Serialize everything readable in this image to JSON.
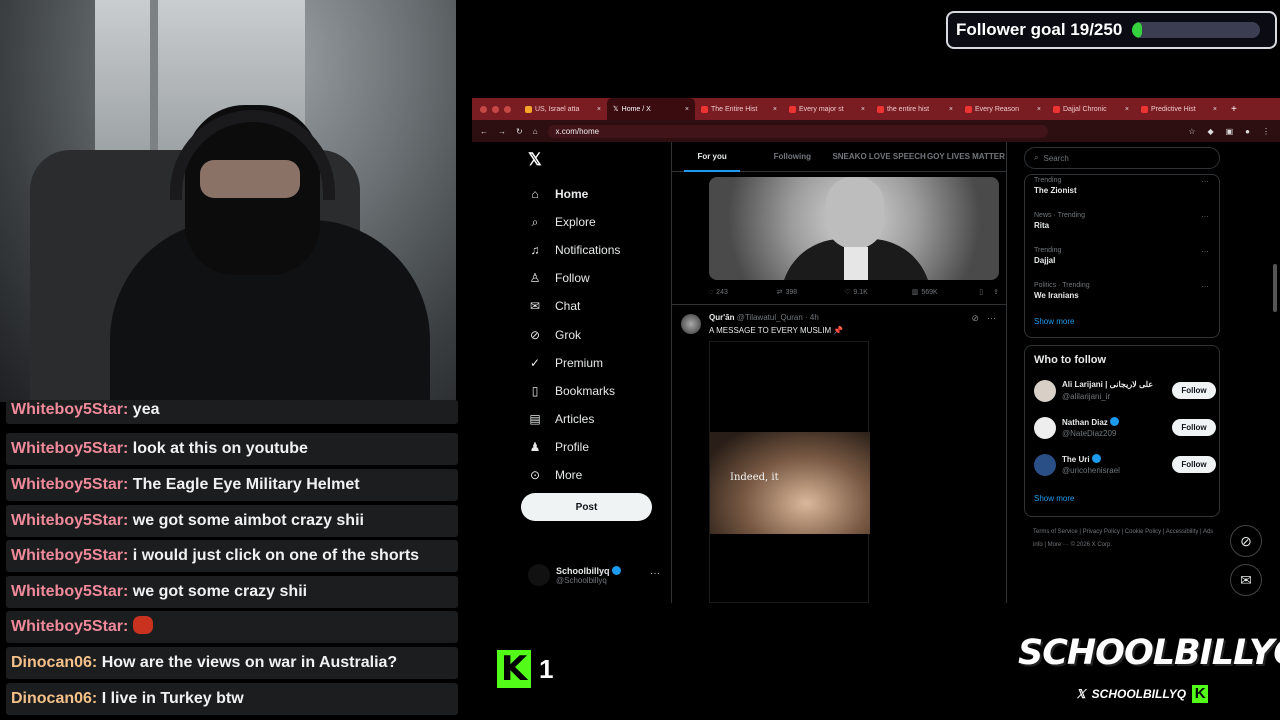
{
  "overlay": {
    "follower_goal": {
      "label": "Follower goal 19/250",
      "current": 19,
      "target": 250,
      "fill_color": "#35d23d"
    },
    "kick_count": "1",
    "brand_name": "SCHOOLBILLYQ",
    "brand_handle": "SCHOOLBILLYQ"
  },
  "chat": {
    "messages": [
      {
        "user": "Whiteboy5Star:",
        "text": "yea"
      },
      {
        "user": "Whiteboy5Star:",
        "text": "look at this on youtube"
      },
      {
        "user": "Whiteboy5Star:",
        "text": "The Eagle Eye Military Helmet"
      },
      {
        "user": "Whiteboy5Star:",
        "text": "we got some aimbot crazy shii"
      },
      {
        "user": "Whiteboy5Star:",
        "text": "i would just click on one of the shorts"
      },
      {
        "user": "Whiteboy5Star:",
        "text": "we got some crazy shii"
      },
      {
        "user": "Whiteboy5Star:",
        "text": ""
      },
      {
        "user": "Dinocan06:",
        "text": "How are the views on war in Australia?"
      },
      {
        "user": "Dinocan06:",
        "text": "I live in Turkey btw"
      }
    ]
  },
  "browser": {
    "tabs": [
      {
        "label": "US, Israel atta"
      },
      {
        "label": "Home / X"
      },
      {
        "label": "The Entire Hist"
      },
      {
        "label": "Every major st"
      },
      {
        "label": "the entire hist"
      },
      {
        "label": "Every Reason"
      },
      {
        "label": "Dajjal Chronic"
      },
      {
        "label": "Predictive Hist"
      }
    ],
    "url": "x.com/home"
  },
  "x": {
    "nav": {
      "home": "Home",
      "explore": "Explore",
      "notifications": "Notifications",
      "follow": "Follow",
      "chat": "Chat",
      "grok": "Grok",
      "premium": "Premium",
      "bookmarks": "Bookmarks",
      "articles": "Articles",
      "profile": "Profile",
      "more": "More",
      "post": "Post"
    },
    "account": {
      "name": "Schoolbillyq",
      "handle": "@Schoolbillyq"
    },
    "feed_tabs": [
      "For you",
      "Following",
      "SNEAKO LOVE SPEECH",
      "GOY LIVES MATTER"
    ],
    "post1": {
      "replies": "243",
      "reposts": "398",
      "likes": "9.1K",
      "views": "569K"
    },
    "post2": {
      "name": "Qur'ān",
      "handle": "@Tilawatul_Quran · 4h",
      "text": "A MESSAGE TO EVERY MUSLIM 📌",
      "video_caption": "Indeed, it"
    },
    "search_placeholder": "Search",
    "trends": [
      {
        "meta": "Trending",
        "title": "The Zionist"
      },
      {
        "meta": "News · Trending",
        "title": "Rita"
      },
      {
        "meta": "Trending",
        "title": "Dajjal"
      },
      {
        "meta": "Politics · Trending",
        "title": "We Iranians"
      }
    ],
    "show_more": "Show more",
    "who_to_follow": {
      "title": "Who to follow",
      "accounts": [
        {
          "name": "Ali Larijani | علی لاریجانی",
          "handle": "@alilarijani_ir"
        },
        {
          "name": "Nathan Diaz",
          "handle": "@NateDiaz209"
        },
        {
          "name": "The Uri",
          "handle": "@uricohenisrael"
        }
      ],
      "follow_label": "Follow",
      "show_more": "Show more"
    },
    "footer": "Terms of Service  |  Privacy Policy  |  Cookie Policy  |  Accessibility  |  Ads info  |  More ···  © 2026 X Corp."
  }
}
